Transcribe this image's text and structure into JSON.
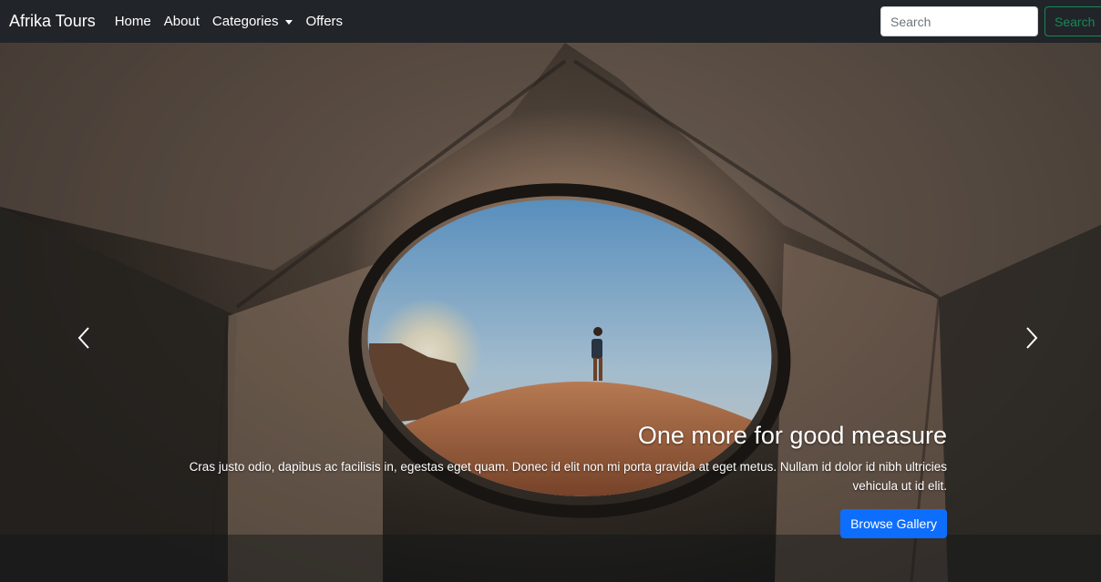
{
  "navbar": {
    "brand": "Afrika Tours",
    "links": [
      "Home",
      "About",
      "Categories",
      "Offers"
    ],
    "search_placeholder": "Search",
    "search_button": "Search"
  },
  "carousel": {
    "caption_title": "One more for good measure",
    "caption_text": "Cras justo odio, dapibus ac facilisis in, egestas eget quam. Donec id elit non mi porta gravida at eget metus. Nullam id dolor id nibh ultricies vehicula ut id elit.",
    "button_label": "Browse Gallery",
    "prev_icon": "chevron-left-icon",
    "next_icon": "chevron-right-icon"
  },
  "colors": {
    "navbar_bg": "#212529",
    "search_button": "#198754",
    "primary_button": "#0d6efd"
  }
}
